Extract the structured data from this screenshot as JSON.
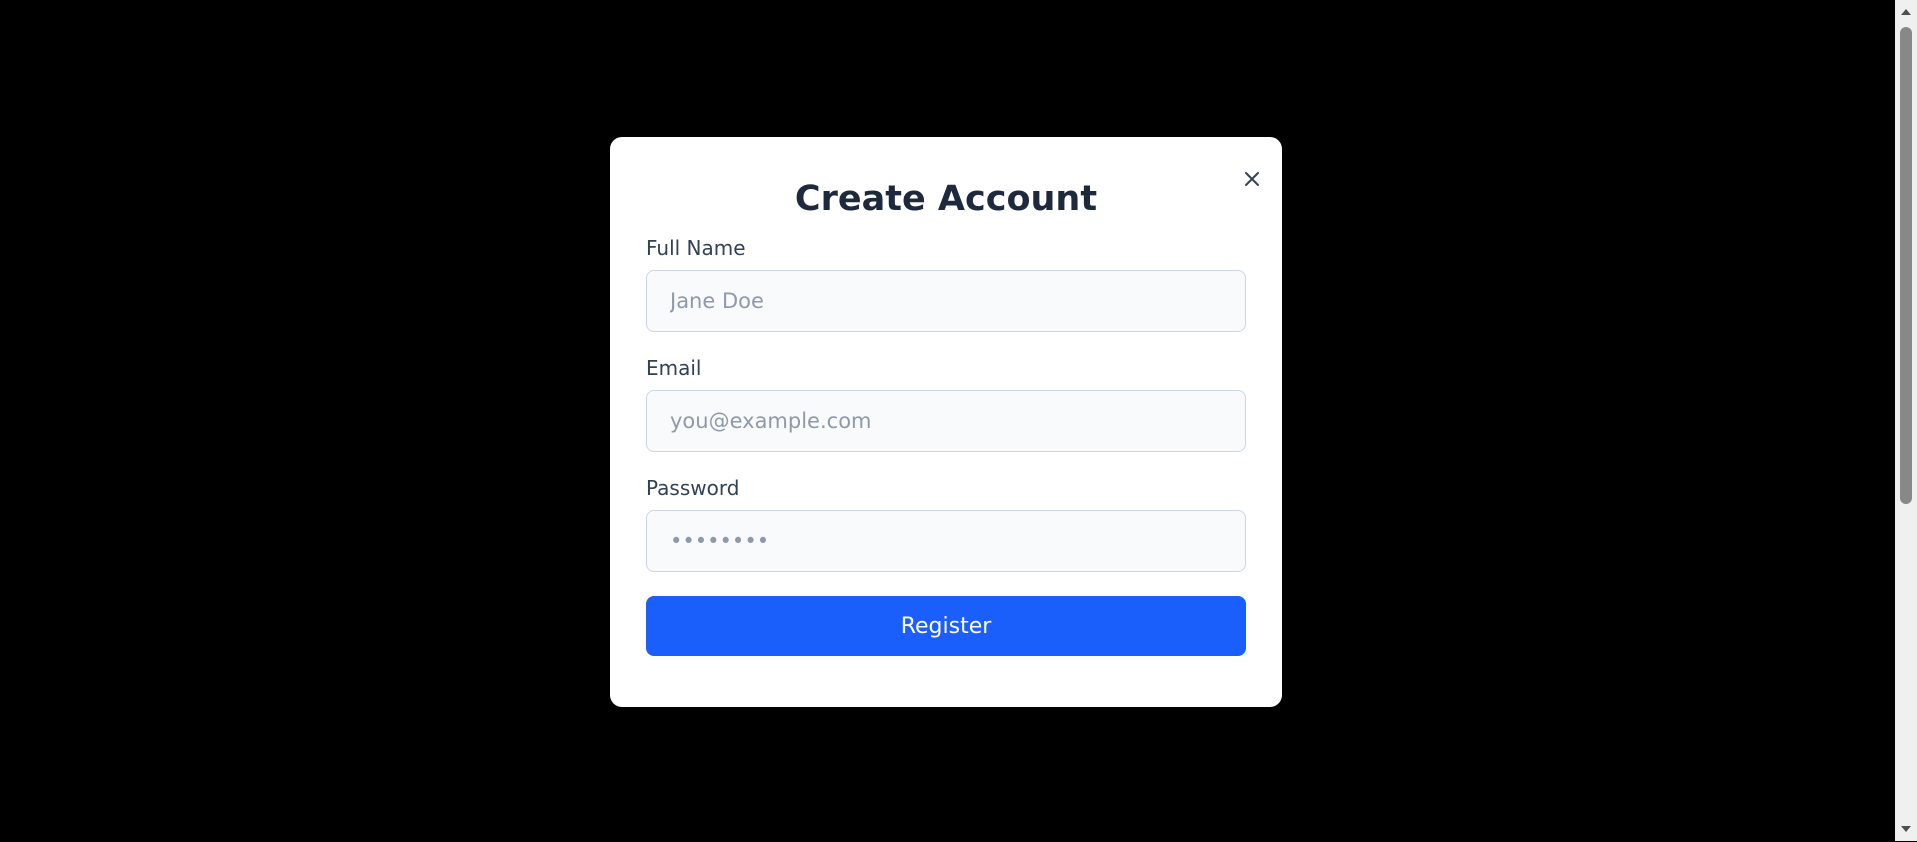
{
  "modal": {
    "title": "Create Account",
    "close_icon": "close-icon"
  },
  "form": {
    "full_name": {
      "label": "Full Name",
      "placeholder": "Jane Doe"
    },
    "email": {
      "label": "Email",
      "placeholder": "you@example.com"
    },
    "password": {
      "label": "Password",
      "placeholder": "••••••••"
    },
    "submit_label": "Register"
  },
  "colors": {
    "accent": "#1a5ffb",
    "backdrop": "#000000",
    "title": "#1e293b"
  },
  "scrollbar": {
    "up_icon": "triangle-up-icon",
    "down_icon": "triangle-down-icon"
  }
}
